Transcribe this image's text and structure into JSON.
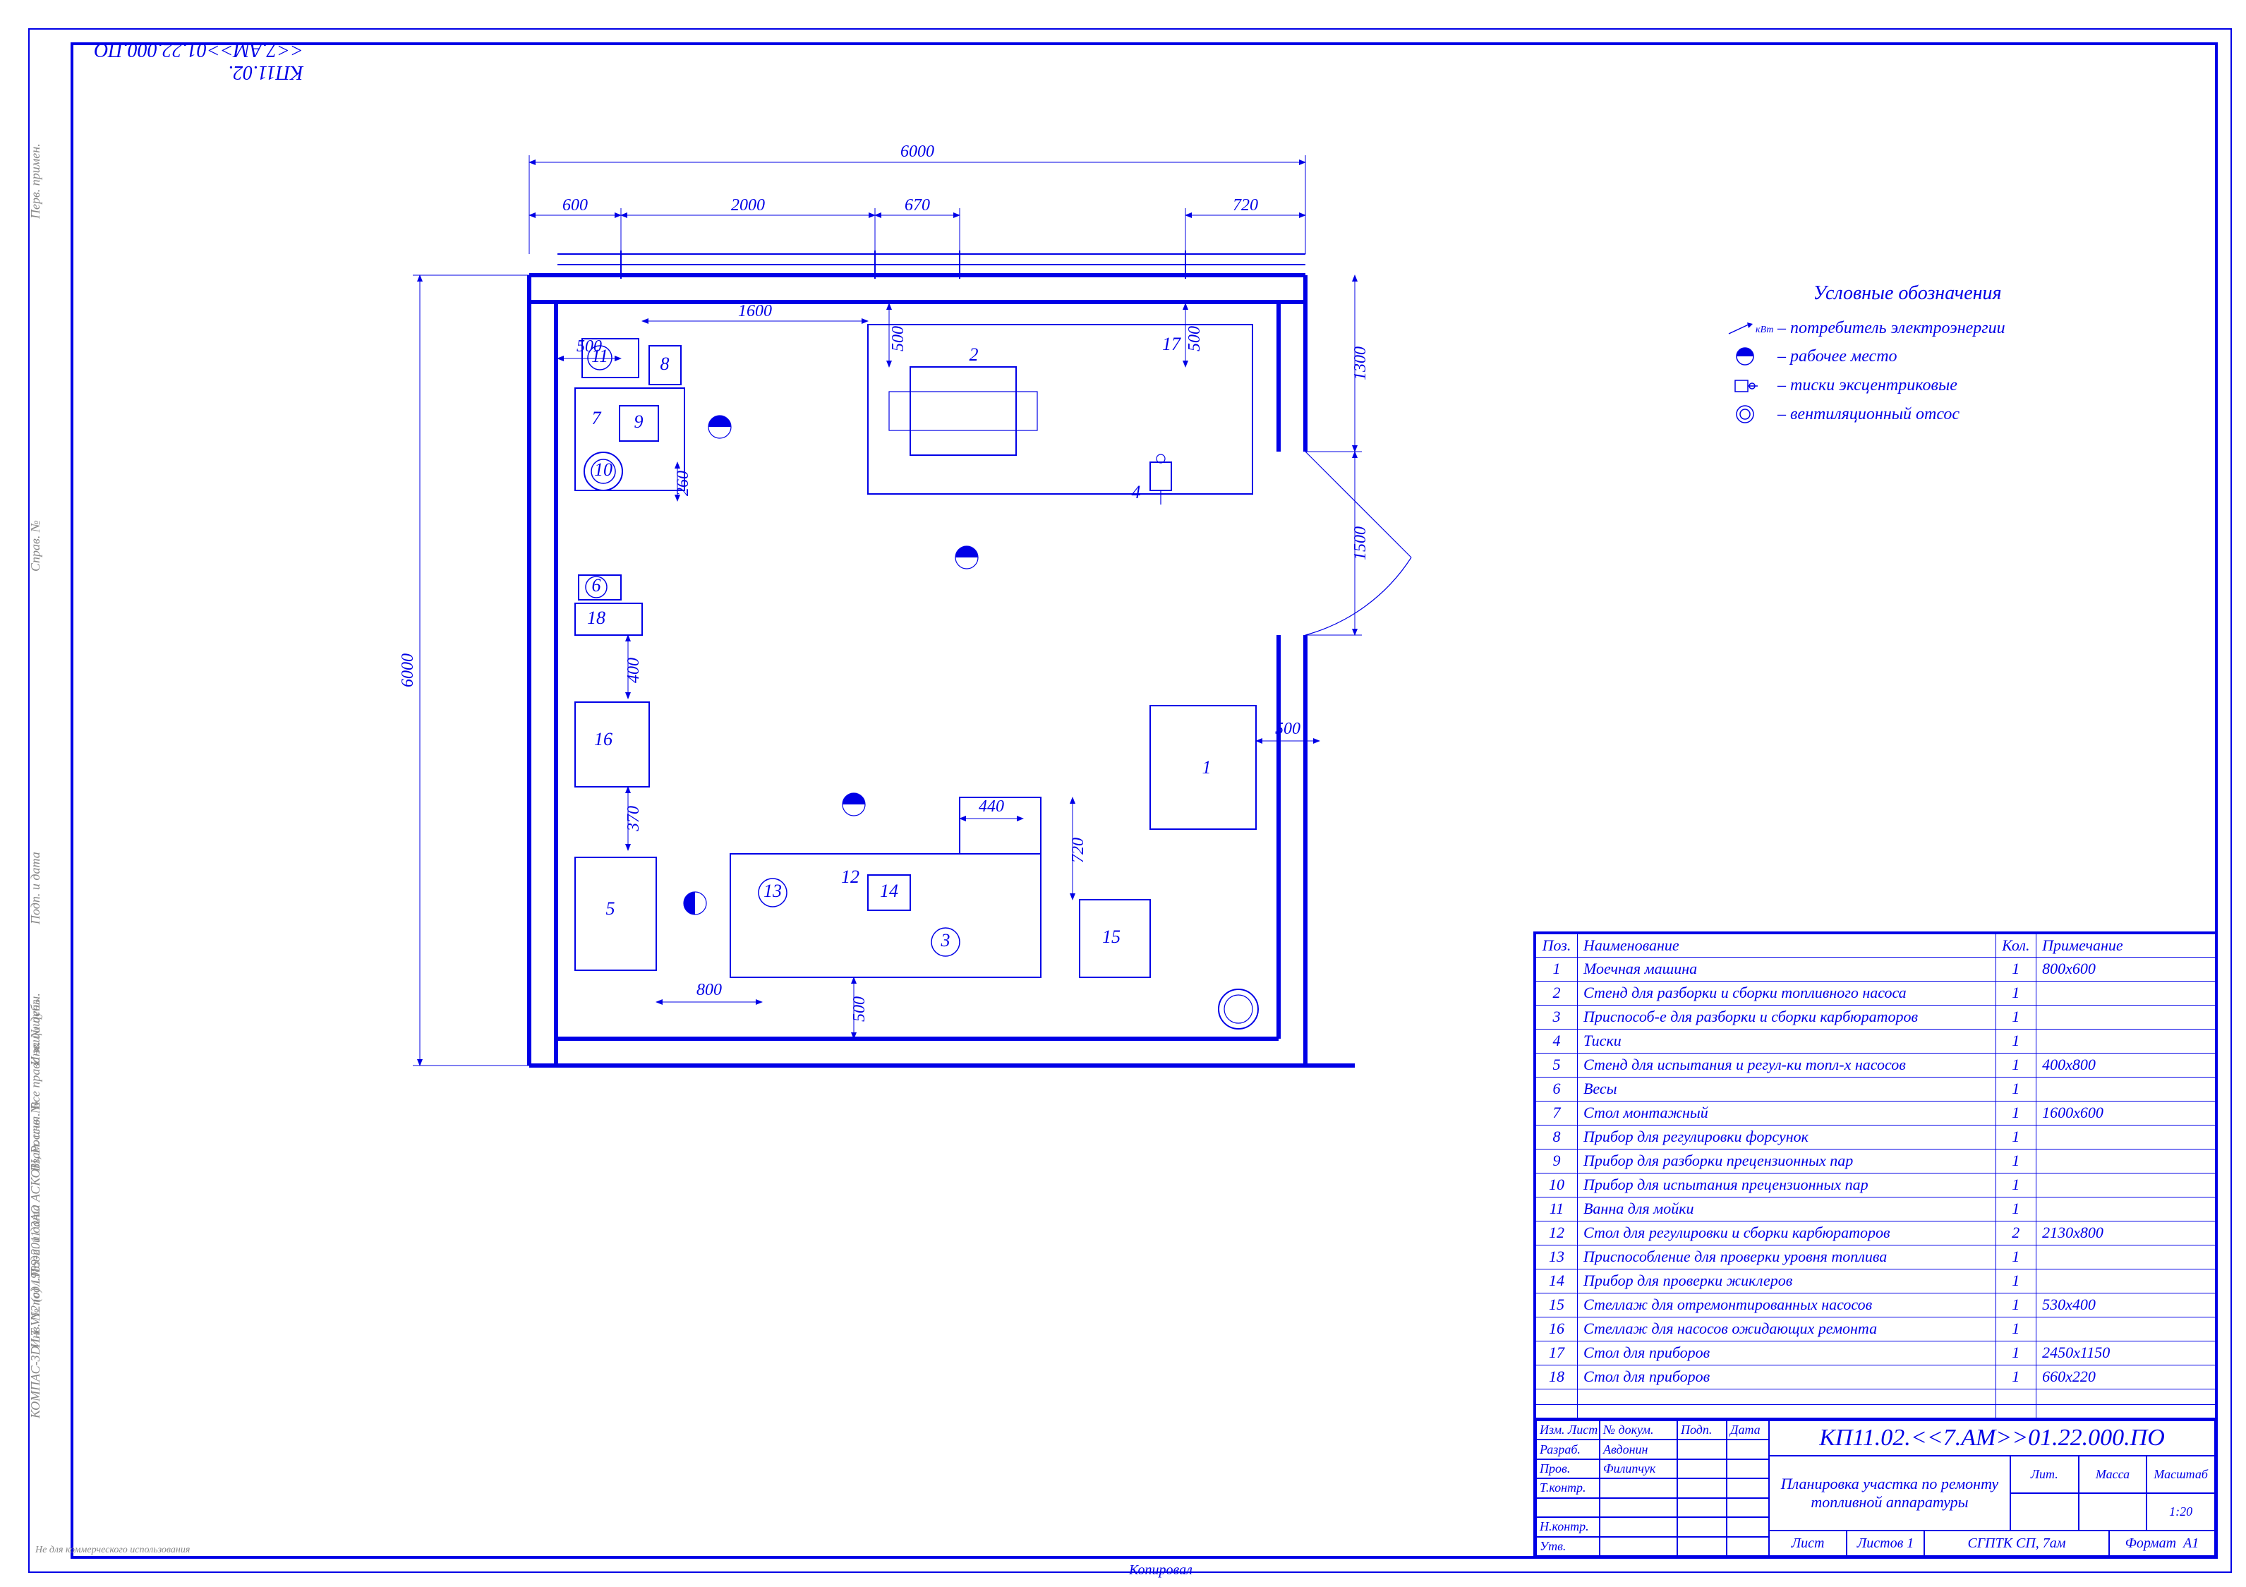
{
  "drawing_code": "КП11.02.<<7.АМ>>01.22.000.ПО",
  "drawing_title": "Планировка участка по ремонту топливной аппаратуры",
  "organization": "СГПТК СП, 7ам",
  "format_label": "Формат",
  "format_value": "А1",
  "footer_copy": "Копировал",
  "scale_label": "Масштаб",
  "scale_value": "1:20",
  "mass_label": "Масса",
  "lit_label": "Лит.",
  "sheet_label": "Лист",
  "sheets_label": "Листов",
  "sheets_value": "1",
  "watermark": "Не для коммерческого использования",
  "side_notes": [
    "КОМПАС-3D LT V12 (c) 1989-2011 ЗАО АСКОН, Россия. Все права защищены.",
    "Перв. примен.",
    "Справ. №",
    "Подп. и дата",
    "Инв. № дубл.",
    "Взам. инв. №",
    "Подп. и дата",
    "Инв. № подл."
  ],
  "signers": {
    "header": [
      "Изм.",
      "Лист",
      "№ докум.",
      "Подп.",
      "Дата"
    ],
    "rows": [
      [
        "Разраб.",
        "Авдонин",
        "",
        ""
      ],
      [
        "Пров.",
        "Филипчук",
        "",
        ""
      ],
      [
        "Т.контр.",
        "",
        "",
        ""
      ],
      [
        "",
        "",
        "",
        ""
      ],
      [
        "Н.контр.",
        "",
        "",
        ""
      ],
      [
        "Утв.",
        "",
        "",
        ""
      ]
    ]
  },
  "legend": {
    "title": "Условные обозначения",
    "items": [
      {
        "sym": "power",
        "text": "– потребитель электроэнергии",
        "prefix": "кВт"
      },
      {
        "sym": "worker",
        "text": "– рабочее место"
      },
      {
        "sym": "vise",
        "text": "– тиски эксцентриковые"
      },
      {
        "sym": "vent",
        "text": "– вентиляционный отсос"
      }
    ]
  },
  "spec": {
    "headers": [
      "Поз.",
      "Наименование",
      "Кол.",
      "Примечание"
    ],
    "rows": [
      [
        "1",
        "Моечная машина",
        "1",
        "800х600"
      ],
      [
        "2",
        "Стенд для разборки и сборки топливного насоса",
        "1",
        ""
      ],
      [
        "3",
        "Приспособ-е для разборки и сборки карбюраторов",
        "1",
        ""
      ],
      [
        "4",
        "Тиски",
        "1",
        ""
      ],
      [
        "5",
        "Стенд для испытания и регул-ки топл-х насосов",
        "1",
        "400х800"
      ],
      [
        "6",
        "Весы",
        "1",
        ""
      ],
      [
        "7",
        "Стол монтажный",
        "1",
        "1600х600"
      ],
      [
        "8",
        "Прибор для регулировки форсунок",
        "1",
        ""
      ],
      [
        "9",
        "Прибор для разборки прецензионных пар",
        "1",
        ""
      ],
      [
        "10",
        "Прибор для испытания прецензионных пар",
        "1",
        ""
      ],
      [
        "11",
        "Ванна для мойки",
        "1",
        ""
      ],
      [
        "12",
        "Стол для регулировки и сборки карбюраторов",
        "2",
        "2130х800"
      ],
      [
        "13",
        "Приспособление для проверки уровня топлива",
        "1",
        ""
      ],
      [
        "14",
        "Прибор для проверки жиклеров",
        "1",
        ""
      ],
      [
        "15",
        "Стеллаж для отремонтированных насосов",
        "1",
        "530х400"
      ],
      [
        "16",
        "Стеллаж для насосов ожидающих ремонта",
        "1",
        ""
      ],
      [
        "17",
        "Стол для приборов",
        "1",
        "2450х1150"
      ],
      [
        "18",
        "Стол для приборов",
        "1",
        "660х220"
      ]
    ]
  },
  "dimensions": {
    "overall_w": "6000",
    "overall_h": "6000",
    "top": [
      "600",
      "2000",
      "670",
      "720"
    ],
    "interior_w": "1600",
    "right_v": [
      "1300",
      "1500"
    ],
    "left_500": "500",
    "eq_500a": "500",
    "eq_500b": "500",
    "eq_500c": "500",
    "eq_500d": "500",
    "d260": "260",
    "d400": "400",
    "d370": "370",
    "d800": "800",
    "d440": "440",
    "d720": "720"
  }
}
